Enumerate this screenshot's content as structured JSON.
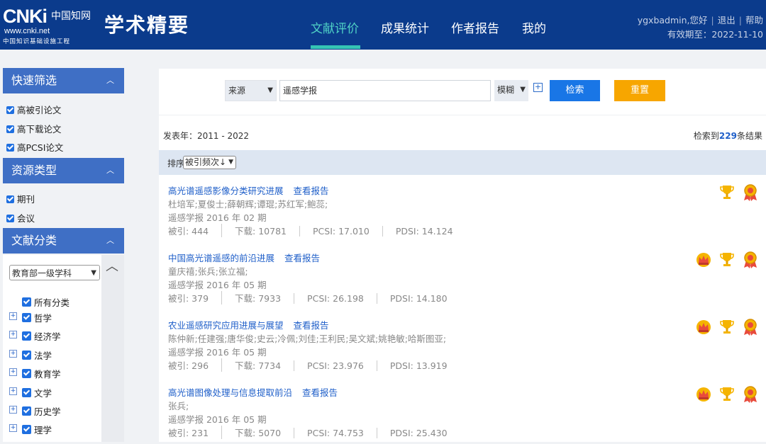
{
  "header": {
    "logo_mark": "CNKi",
    "logo_cn": "中国知网",
    "logo_url": "www.cnki.net",
    "logo_sub": "中国知识基础设施工程",
    "brand": "学术精要",
    "nav": [
      {
        "label": "文献评价",
        "active": true
      },
      {
        "label": "成果统计",
        "active": false
      },
      {
        "label": "作者报告",
        "active": false
      },
      {
        "label": "我的",
        "active": false
      }
    ],
    "user_greeting": "ygxbadmin,您好",
    "logout": "退出",
    "help": "帮助",
    "expire": "有效期至：2022-11-10"
  },
  "sidebar": {
    "quick_filter": {
      "title": "快速筛选",
      "items": [
        "高被引论文",
        "高下载论文",
        "高PCSI论文"
      ]
    },
    "resource_type": {
      "title": "资源类型",
      "items": [
        "期刊",
        "会议"
      ]
    },
    "doc_class": {
      "title": "文献分类",
      "select": "教育部一级学科",
      "all": "所有分类",
      "items": [
        "哲学",
        "经济学",
        "法学",
        "教育学",
        "文学",
        "历史学",
        "理学"
      ]
    }
  },
  "search": {
    "source": "来源",
    "keyword": "遥感学报",
    "match": "模糊",
    "add": "+",
    "search_btn": "检索",
    "reset_btn": "重置"
  },
  "info": {
    "year_range": "发表年：2011 - 2022",
    "count_prefix": "检索到",
    "count": "229",
    "count_suffix": "条结果"
  },
  "sort": {
    "label": "排序",
    "value": "被引频次↓"
  },
  "results": [
    {
      "title": "高光谱遥感影像分类研究进展",
      "report": "查看报告",
      "authors": "杜培军;夏俊士;薛朝辉;谭琨;苏红军;鲍蕊;",
      "journal": "遥感学报 2016 年 02 期",
      "cited": "被引: 444",
      "download": "下载: 10781",
      "pcsi": "PCSI: 17.010",
      "pdsi": "PDSI: 14.124",
      "badges": [
        "trophy-icon",
        "medal-icon"
      ]
    },
    {
      "title": "中国高光谱遥感的前沿进展",
      "report": "查看报告",
      "authors": "童庆禧;张兵;张立福;",
      "journal": "遥感学报 2016 年 05 期",
      "cited": "被引: 379",
      "download": "下载: 7933",
      "pcsi": "PCSI: 26.198",
      "pdsi": "PDSI: 14.180",
      "badges": [
        "crown-icon",
        "trophy-icon",
        "medal-icon"
      ]
    },
    {
      "title": "农业遥感研究应用进展与展望",
      "report": "查看报告",
      "authors": "陈仲新;任建强;唐华俊;史云;冷佩;刘佳;王利民;吴文斌;姚艳敏;哈斯图亚;",
      "journal": "遥感学报 2016 年 05 期",
      "cited": "被引: 296",
      "download": "下载: 7734",
      "pcsi": "PCSI: 23.976",
      "pdsi": "PDSI: 13.919",
      "badges": [
        "crown-icon",
        "trophy-icon",
        "medal-icon"
      ]
    },
    {
      "title": "高光谱图像处理与信息提取前沿",
      "report": "查看报告",
      "authors": "张兵;",
      "journal": "遥感学报 2016 年 05 期",
      "cited": "被引: 231",
      "download": "下载: 5070",
      "pcsi": "PCSI: 74.753",
      "pdsi": "PDSI: 25.430",
      "badges": [
        "crown-icon",
        "trophy-icon",
        "medal-icon"
      ]
    }
  ],
  "colors": {
    "header_bg": "#0b3b8c",
    "nav_active": "#4fd1c5",
    "side_head": "#3f6fc5",
    "link": "#1f5fc9",
    "search_btn": "#1976e6",
    "reset_btn": "#f7a600"
  }
}
